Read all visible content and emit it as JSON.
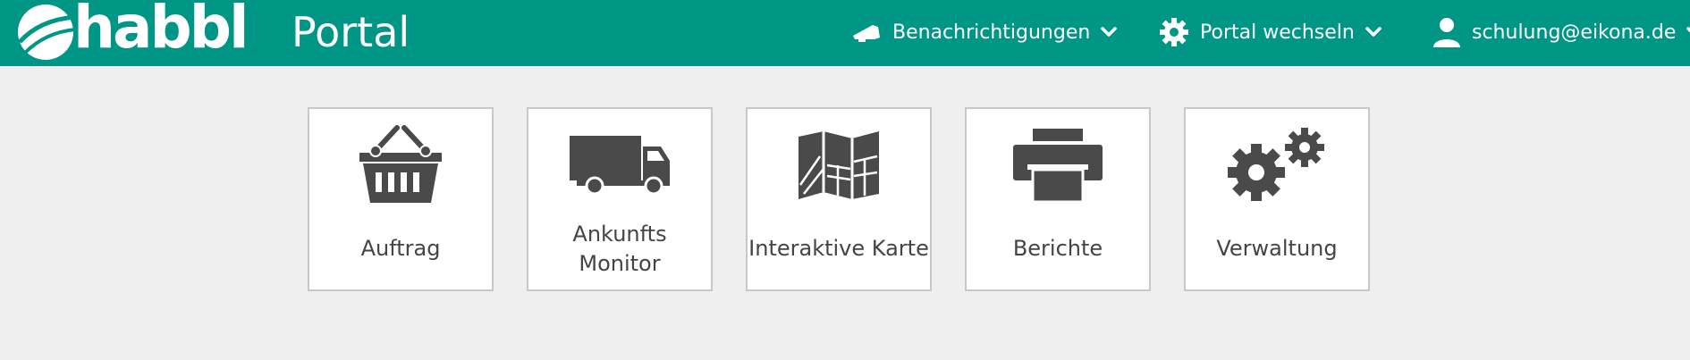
{
  "header": {
    "logo_text": "habbl",
    "title": "Portal",
    "notifications_label": "Benachrichtigungen",
    "switch_portal_label": "Portal wechseln",
    "user_label": "schulung@eikona.de",
    "accent_color": "#009686"
  },
  "tiles": [
    {
      "label": "Auftrag",
      "icon": "basket-icon"
    },
    {
      "label_line1": "Ankunfts",
      "label_line2": "Monitor",
      "icon": "truck-icon"
    },
    {
      "label": "Interaktive Karte",
      "icon": "map-icon"
    },
    {
      "label": "Berichte",
      "icon": "printer-icon"
    },
    {
      "label": "Verwaltung",
      "icon": "gears-icon"
    }
  ]
}
